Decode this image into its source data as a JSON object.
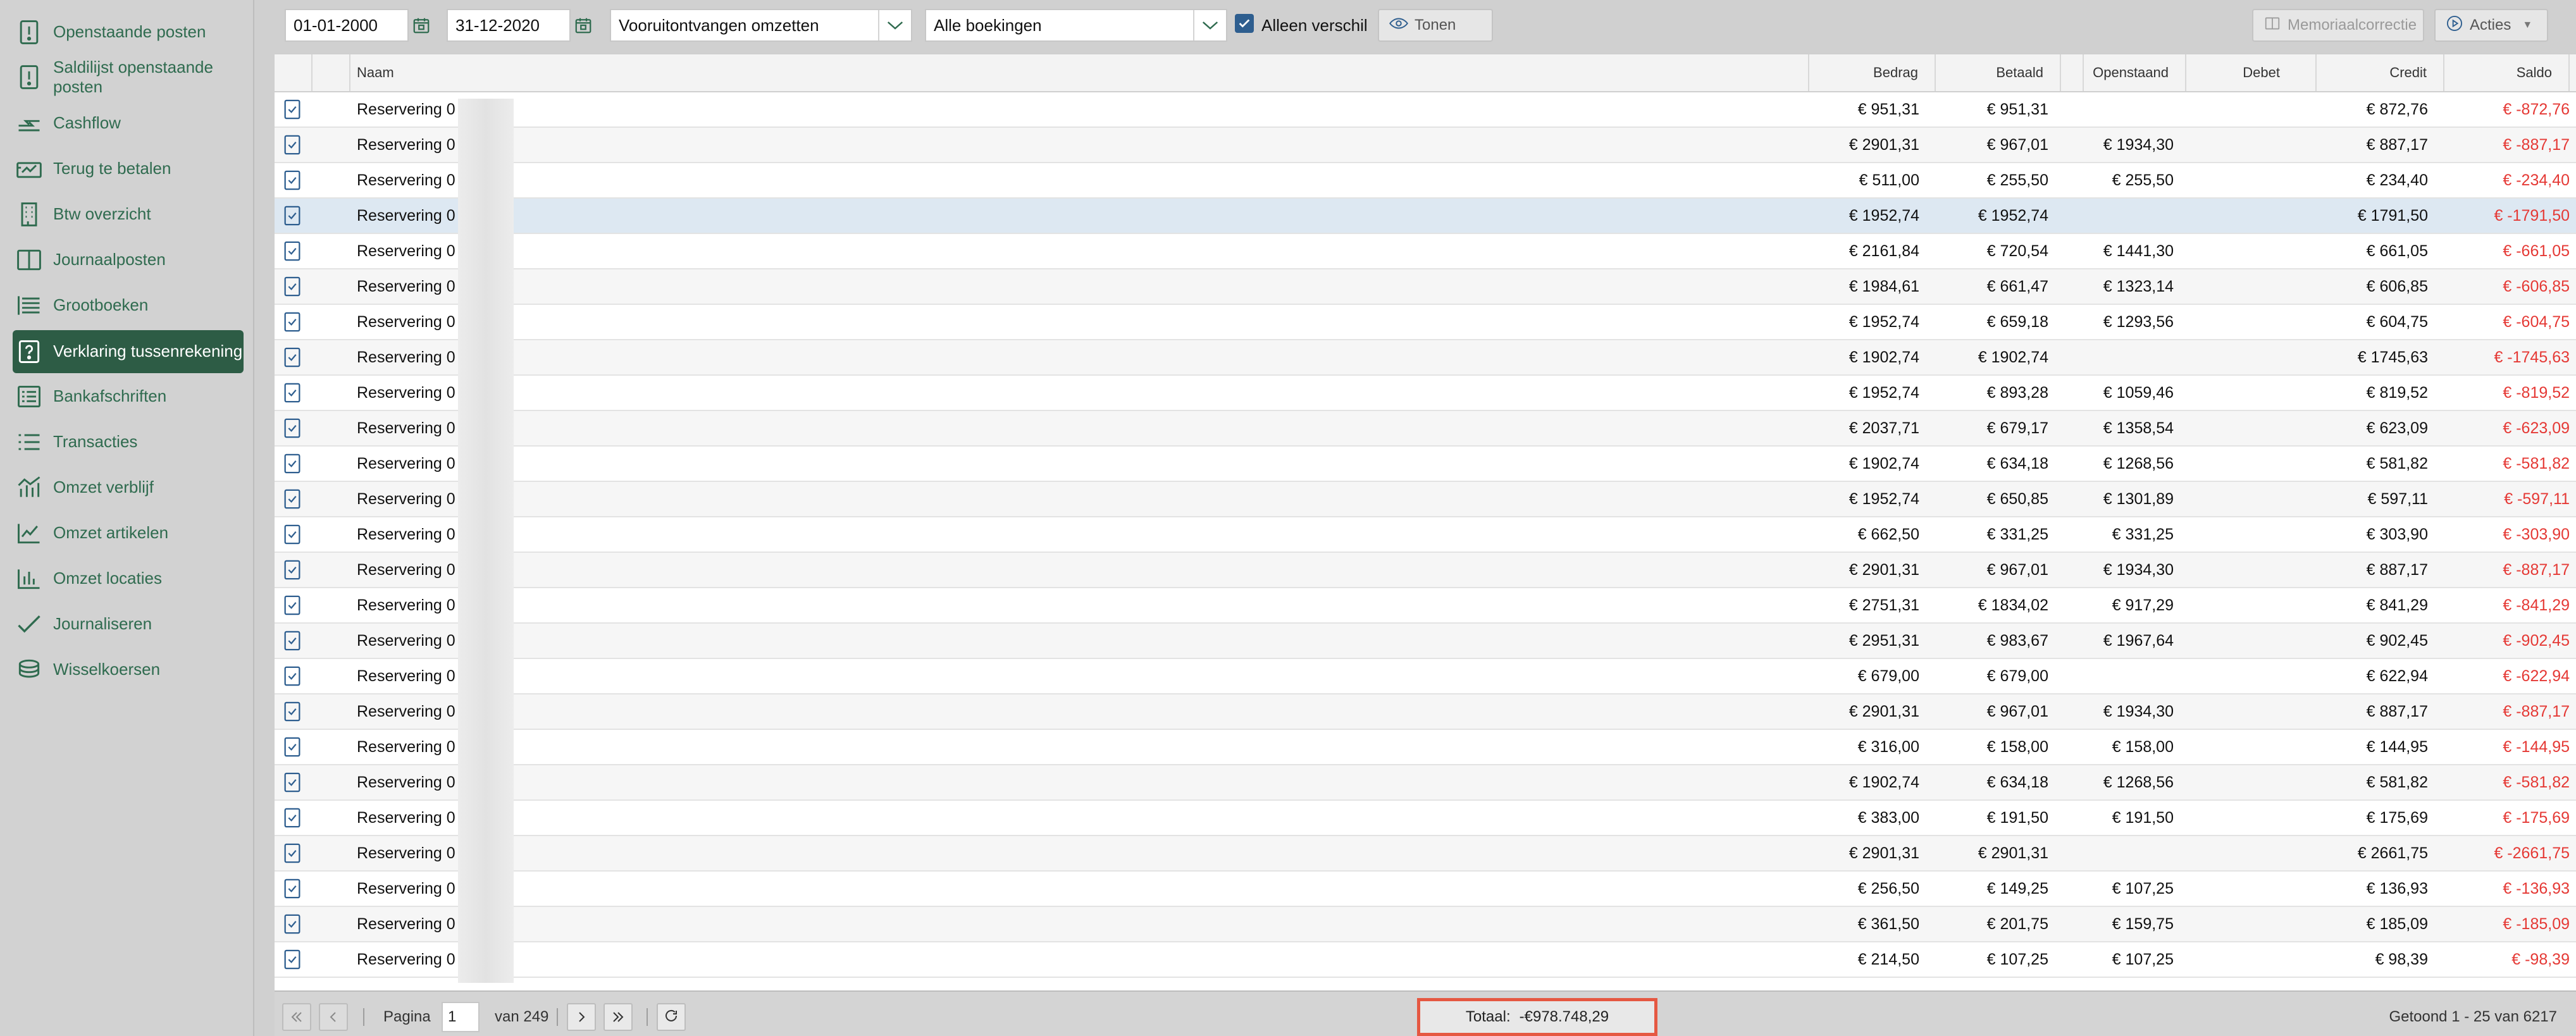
{
  "sidebar": {
    "items": [
      {
        "label": "Openstaande posten",
        "icon": "alert-document-icon",
        "active": false
      },
      {
        "label": "Saldilijst openstaande posten",
        "icon": "alert-document-icon",
        "active": false
      },
      {
        "label": "Cashflow",
        "icon": "cashflow-icon",
        "active": false
      },
      {
        "label": "Terug te betalen",
        "icon": "refund-icon",
        "active": false
      },
      {
        "label": "Btw overzicht",
        "icon": "building-icon",
        "active": false
      },
      {
        "label": "Journaalposten",
        "icon": "book-icon",
        "active": false
      },
      {
        "label": "Grootboeken",
        "icon": "ledger-list-icon",
        "active": false
      },
      {
        "label": "Verklaring tussenrekening",
        "icon": "question-icon",
        "active": true
      },
      {
        "label": "Bankafschriften",
        "icon": "statement-icon",
        "active": false
      },
      {
        "label": "Transacties",
        "icon": "list-icon",
        "active": false
      },
      {
        "label": "Omzet verblijf",
        "icon": "chart-bars-line-icon",
        "active": false
      },
      {
        "label": "Omzet artikelen",
        "icon": "trend-chart-icon",
        "active": false
      },
      {
        "label": "Omzet locaties",
        "icon": "bar-chart-icon",
        "active": false
      },
      {
        "label": "Journaliseren",
        "icon": "check-icon",
        "active": false
      },
      {
        "label": "Wisselkoersen",
        "icon": "coins-icon",
        "active": false
      }
    ]
  },
  "toolbar": {
    "date_from": "01-01-2000",
    "date_to": "31-12-2020",
    "type_select": "Vooruitontvangen omzetten",
    "bookings_select": "Alle boekingen",
    "only_diff_label": "Alleen verschil",
    "only_diff_checked": true,
    "show_label": "Tonen",
    "memorial_label": "Memoriaalcorrectie",
    "actions_label": "Acties"
  },
  "table": {
    "columns": {
      "name": "Naam",
      "amount": "Bedrag",
      "paid": "Betaald",
      "outstanding": "Openstaand",
      "debit": "Debet",
      "credit": "Credit",
      "balance": "Saldo"
    },
    "rows": [
      {
        "name": "Reservering 0",
        "amount": "€ 951,31",
        "paid": "€ 951,31",
        "outstanding": "",
        "debit": "",
        "credit": "€ 872,76",
        "balance": "€ -872,76"
      },
      {
        "name": "Reservering 0",
        "amount": "€ 2901,31",
        "paid": "€ 967,01",
        "outstanding": "€ 1934,30",
        "debit": "",
        "credit": "€ 887,17",
        "balance": "€ -887,17"
      },
      {
        "name": "Reservering 0",
        "amount": "€ 511,00",
        "paid": "€ 255,50",
        "outstanding": "€ 255,50",
        "debit": "",
        "credit": "€ 234,40",
        "balance": "€ -234,40"
      },
      {
        "name": "Reservering 0",
        "amount": "€ 1952,74",
        "paid": "€ 1952,74",
        "outstanding": "",
        "debit": "",
        "credit": "€ 1791,50",
        "balance": "€ -1791,50"
      },
      {
        "name": "Reservering 0",
        "amount": "€ 2161,84",
        "paid": "€ 720,54",
        "outstanding": "€ 1441,30",
        "debit": "",
        "credit": "€ 661,05",
        "balance": "€ -661,05"
      },
      {
        "name": "Reservering 0",
        "amount": "€ 1984,61",
        "paid": "€ 661,47",
        "outstanding": "€ 1323,14",
        "debit": "",
        "credit": "€ 606,85",
        "balance": "€ -606,85"
      },
      {
        "name": "Reservering 0",
        "amount": "€ 1952,74",
        "paid": "€ 659,18",
        "outstanding": "€ 1293,56",
        "debit": "",
        "credit": "€ 604,75",
        "balance": "€ -604,75"
      },
      {
        "name": "Reservering 0",
        "amount": "€ 1902,74",
        "paid": "€ 1902,74",
        "outstanding": "",
        "debit": "",
        "credit": "€ 1745,63",
        "balance": "€ -1745,63"
      },
      {
        "name": "Reservering 0",
        "amount": "€ 1952,74",
        "paid": "€ 893,28",
        "outstanding": "€ 1059,46",
        "debit": "",
        "credit": "€ 819,52",
        "balance": "€ -819,52"
      },
      {
        "name": "Reservering 0",
        "amount": "€ 2037,71",
        "paid": "€ 679,17",
        "outstanding": "€ 1358,54",
        "debit": "",
        "credit": "€ 623,09",
        "balance": "€ -623,09"
      },
      {
        "name": "Reservering 0",
        "amount": "€ 1902,74",
        "paid": "€ 634,18",
        "outstanding": "€ 1268,56",
        "debit": "",
        "credit": "€ 581,82",
        "balance": "€ -581,82"
      },
      {
        "name": "Reservering 0",
        "amount": "€ 1952,74",
        "paid": "€ 650,85",
        "outstanding": "€ 1301,89",
        "debit": "",
        "credit": "€ 597,11",
        "balance": "€ -597,11"
      },
      {
        "name": "Reservering 0",
        "amount": "€ 662,50",
        "paid": "€ 331,25",
        "outstanding": "€ 331,25",
        "debit": "",
        "credit": "€ 303,90",
        "balance": "€ -303,90"
      },
      {
        "name": "Reservering 0",
        "amount": "€ 2901,31",
        "paid": "€ 967,01",
        "outstanding": "€ 1934,30",
        "debit": "",
        "credit": "€ 887,17",
        "balance": "€ -887,17"
      },
      {
        "name": "Reservering 0",
        "amount": "€ 2751,31",
        "paid": "€ 1834,02",
        "outstanding": "€ 917,29",
        "debit": "",
        "credit": "€ 841,29",
        "balance": "€ -841,29"
      },
      {
        "name": "Reservering 0",
        "amount": "€ 2951,31",
        "paid": "€ 983,67",
        "outstanding": "€ 1967,64",
        "debit": "",
        "credit": "€ 902,45",
        "balance": "€ -902,45"
      },
      {
        "name": "Reservering 0",
        "amount": "€ 679,00",
        "paid": "€ 679,00",
        "outstanding": "",
        "debit": "",
        "credit": "€ 622,94",
        "balance": "€ -622,94"
      },
      {
        "name": "Reservering 0",
        "amount": "€ 2901,31",
        "paid": "€ 967,01",
        "outstanding": "€ 1934,30",
        "debit": "",
        "credit": "€ 887,17",
        "balance": "€ -887,17"
      },
      {
        "name": "Reservering 0",
        "amount": "€ 316,00",
        "paid": "€ 158,00",
        "outstanding": "€ 158,00",
        "debit": "",
        "credit": "€ 144,95",
        "balance": "€ -144,95"
      },
      {
        "name": "Reservering 0",
        "amount": "€ 1902,74",
        "paid": "€ 634,18",
        "outstanding": "€ 1268,56",
        "debit": "",
        "credit": "€ 581,82",
        "balance": "€ -581,82"
      },
      {
        "name": "Reservering 0",
        "amount": "€ 383,00",
        "paid": "€ 191,50",
        "outstanding": "€ 191,50",
        "debit": "",
        "credit": "€ 175,69",
        "balance": "€ -175,69"
      },
      {
        "name": "Reservering 0",
        "amount": "€ 2901,31",
        "paid": "€ 2901,31",
        "outstanding": "",
        "debit": "",
        "credit": "€ 2661,75",
        "balance": "€ -2661,75"
      },
      {
        "name": "Reservering 0",
        "amount": "€ 256,50",
        "paid": "€ 149,25",
        "outstanding": "€ 107,25",
        "debit": "",
        "credit": "€ 136,93",
        "balance": "€ -136,93"
      },
      {
        "name": "Reservering 0",
        "amount": "€ 361,50",
        "paid": "€ 201,75",
        "outstanding": "€ 159,75",
        "debit": "",
        "credit": "€ 185,09",
        "balance": "€ -185,09"
      },
      {
        "name": "Reservering 0",
        "amount": "€ 214,50",
        "paid": "€ 107,25",
        "outstanding": "€ 107,25",
        "debit": "",
        "credit": "€ 98,39",
        "balance": "€ -98,39"
      }
    ],
    "selected_row": 3
  },
  "footer": {
    "page_label": "Pagina",
    "page_value": "1",
    "of_label": "van 249",
    "total_label": "Totaal:",
    "total_value": "-€978.748,29",
    "shown_text": "Getoond 1 - 25 van 6217"
  },
  "colors": {
    "accent": "#2d5c45",
    "sidebar_text": "#2f6b4f",
    "negative": "#e53935",
    "highlight_border": "#e55842"
  }
}
